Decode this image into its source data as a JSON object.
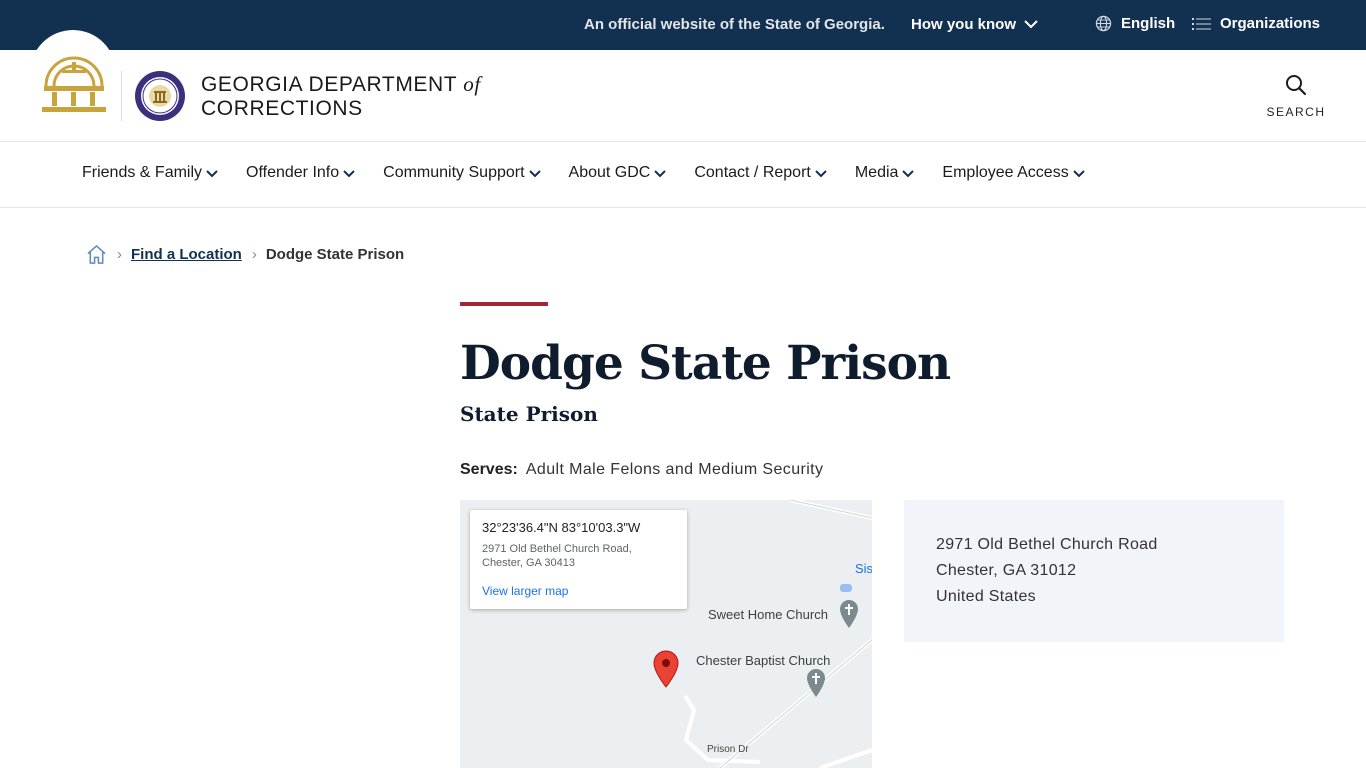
{
  "topbar": {
    "official_text": "An official website of the State of Georgia.",
    "how_you_know": "How you know",
    "language": "English",
    "organizations": "Organizations"
  },
  "header": {
    "dept_line1": "GEORGIA DEPARTMENT",
    "dept_of": "of",
    "dept_line2": "CORRECTIONS",
    "search_label": "SEARCH"
  },
  "nav": {
    "items": [
      {
        "label": "Friends & Family"
      },
      {
        "label": "Offender Info"
      },
      {
        "label": "Community Support"
      },
      {
        "label": "About GDC"
      },
      {
        "label": "Contact / Report"
      },
      {
        "label": "Media"
      },
      {
        "label": "Employee Access"
      }
    ]
  },
  "breadcrumb": {
    "link": "Find a Location",
    "current": "Dodge State Prison"
  },
  "main": {
    "title": "Dodge State Prison",
    "subtitle": "State Prison",
    "serves_label": "Serves:",
    "serves_value": "Adult Male Felons and Medium Security"
  },
  "map": {
    "coords": "32°23'36.4\"N 83°10'03.3\"W",
    "address": "2971 Old Bethel Church Road, Chester, GA 30413",
    "view_larger": "View larger map",
    "labels": {
      "sweet_home": "Sweet Home Church",
      "chester_baptist": "Chester Baptist Church",
      "sis": "Sis",
      "prison_dr": "Prison Dr"
    }
  },
  "address_box": {
    "line1": "2971 Old Bethel Church Road",
    "line2": "Chester, GA 31012",
    "line3": "United States"
  },
  "colors": {
    "topbar": "#12304f",
    "accent": "#a12730",
    "gold": "#c9a43a",
    "link_blue": "#1a73e8"
  }
}
